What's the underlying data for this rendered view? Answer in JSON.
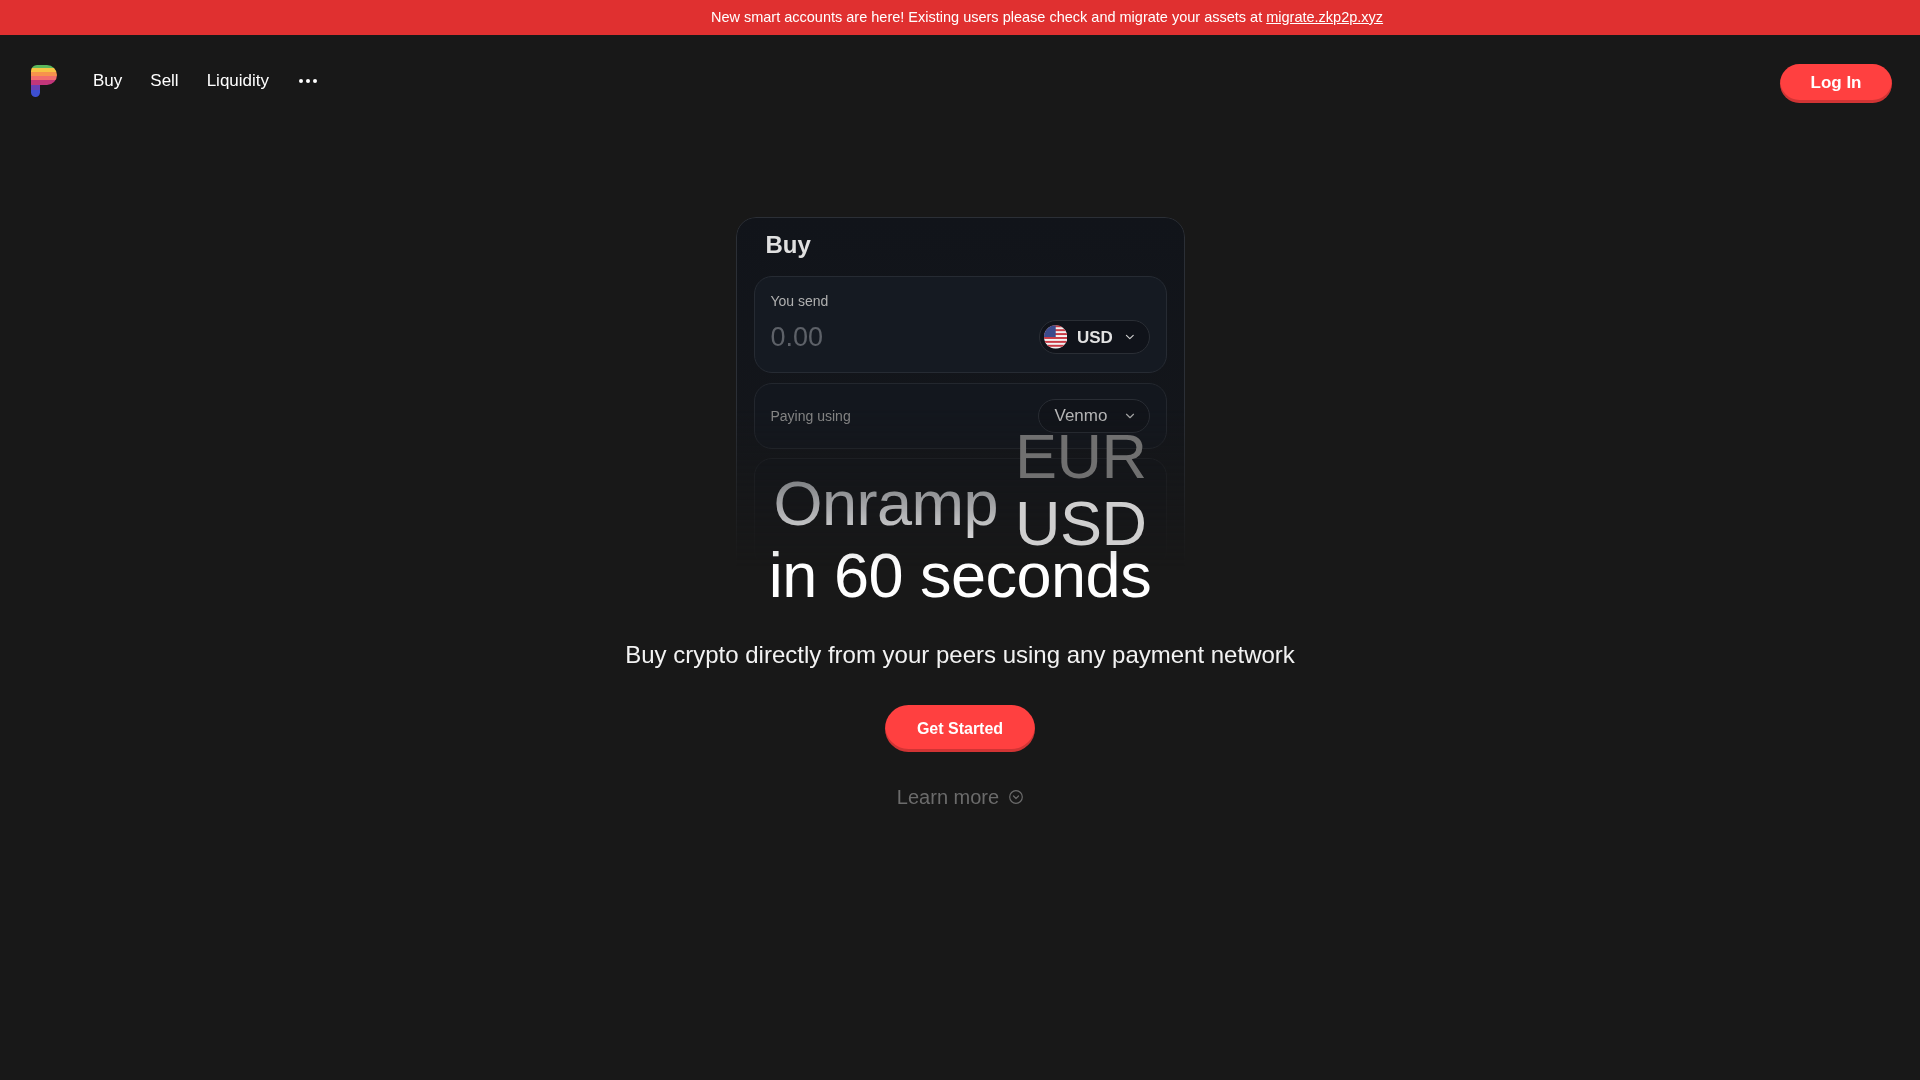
{
  "banner": {
    "text": "New smart accounts are here! Existing users please check and migrate your assets at",
    "link": "migrate.zkp2p.xyz"
  },
  "nav": {
    "items": [
      {
        "label": "Buy"
      },
      {
        "label": "Sell"
      },
      {
        "label": "Liquidity"
      }
    ],
    "login": "Log In"
  },
  "preview_card": {
    "title": "Buy",
    "send": {
      "label": "You send",
      "placeholder": "0.00",
      "currency": "USD"
    },
    "payment": {
      "label": "Paying using",
      "method": "Venmo"
    }
  },
  "hero": {
    "title_start": "Onramp",
    "rolling_words": [
      {
        "text": "EUR",
        "selected": false
      },
      {
        "text": "USD",
        "selected": true
      }
    ],
    "title_end": "in 60 seconds",
    "subtitle": "Buy crypto directly from your peers using any payment network",
    "cta": "Get Started",
    "learn_more": "Learn more"
  }
}
